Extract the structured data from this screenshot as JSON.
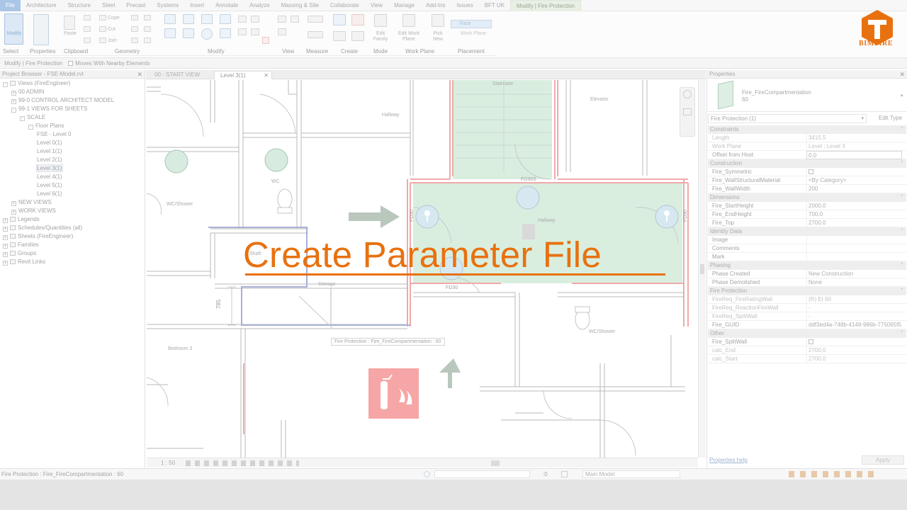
{
  "ribbon": {
    "tabs": [
      "File",
      "Architecture",
      "Structure",
      "Steel",
      "Precast",
      "Systems",
      "Insert",
      "Annotate",
      "Analyze",
      "Massing & Site",
      "Collaborate",
      "View",
      "Manage",
      "Add-Ins",
      "Issues",
      "BFT UK",
      "Modify | Fire Protection"
    ],
    "buttons": {
      "modify": "Modify",
      "paste": "Paste",
      "cope": "Cope",
      "cut": "Cut",
      "join": "Join",
      "edit_family": "Edit Family",
      "edit_work_plane": "Edit Work Plane",
      "pick_new": "Pick New",
      "face": "Face",
      "work_plane": "Work Plane"
    },
    "panels": [
      "Select",
      "Properties",
      "Clipboard",
      "Geometry",
      "Modify",
      "View",
      "Measure",
      "Create",
      "Mode",
      "Work Plane",
      "Placement"
    ]
  },
  "options_bar": {
    "label": "Modify | Fire Protection",
    "checkbox_label": "Moves With Nearby Elements"
  },
  "project_browser": {
    "title": "Project Browser - FSE-Model.rvt",
    "items": [
      {
        "label": "Views (FireEngineer)",
        "level": 0,
        "toggle": "-",
        "icon": true
      },
      {
        "label": "00 ADMIN",
        "level": 1,
        "toggle": "+"
      },
      {
        "label": "99-0 CONTROL ARCHITECT MODEL",
        "level": 1,
        "toggle": "+"
      },
      {
        "label": "99-1 VIEWS FOR SHEETS",
        "level": 1,
        "toggle": "-"
      },
      {
        "label": "SCALE",
        "level": 2,
        "toggle": "-"
      },
      {
        "label": "Floor Plans",
        "level": 3,
        "toggle": "-"
      },
      {
        "label": "FSE - Level 0",
        "level": 4
      },
      {
        "label": "Level 0(1)",
        "level": 4
      },
      {
        "label": "Level 1(1)",
        "level": 4
      },
      {
        "label": "Level 2(1)",
        "level": 4
      },
      {
        "label": "Level 3(1)",
        "level": 4,
        "selected": true
      },
      {
        "label": "Level 4(1)",
        "level": 4
      },
      {
        "label": "Level 5(1)",
        "level": 4
      },
      {
        "label": "Level 6(1)",
        "level": 4
      },
      {
        "label": "NEW VIEWS",
        "level": 1,
        "toggle": "+"
      },
      {
        "label": "WORK VIEWS",
        "level": 1,
        "toggle": "+"
      },
      {
        "label": "Legends",
        "level": 0,
        "toggle": "+",
        "icon": true
      },
      {
        "label": "Schedules/Quantities (all)",
        "level": 0,
        "toggle": "+",
        "icon": true
      },
      {
        "label": "Sheets (FireEngineer)",
        "level": 0,
        "toggle": "+",
        "icon": true
      },
      {
        "label": "Families",
        "level": 0,
        "toggle": "+",
        "icon": true
      },
      {
        "label": "Groups",
        "level": 0,
        "toggle": "+",
        "icon": true
      },
      {
        "label": "Revit Links",
        "level": 0,
        "toggle": "+",
        "icon": true
      }
    ]
  },
  "view_tabs": [
    "00 - START VIEW",
    "Level 3(1)"
  ],
  "plan": {
    "rooms": [
      "Staircase",
      "Hallway",
      "Elevator",
      "WC",
      "WC/Shower",
      "Shaft",
      "Storage",
      "Hallway",
      "Bedroom 3",
      "WC/Shower"
    ],
    "tags": [
      "FD30S",
      "FD30",
      "FD30",
      "FD30"
    ],
    "dimension": "785",
    "tooltip": "Fire Protection : Fire_FireCompartmentation : 60",
    "scale": "1 : 50"
  },
  "banner": {
    "title": "Create Parameter File"
  },
  "logo": {
    "text": "BIMFIRE"
  },
  "properties": {
    "title": "Properties",
    "family": "Fire_FireCompartmentation",
    "type": "60",
    "selector": "Fire Protection (1)",
    "edit_type": "Edit Type",
    "sections": [
      {
        "name": "Constraints",
        "rows": [
          [
            "Length",
            "3415.5",
            true
          ],
          [
            "Work Plane",
            "Level : Level 3",
            true
          ],
          [
            "Offset from Host",
            "0.0",
            false
          ]
        ]
      },
      {
        "name": "Construction",
        "rows": [
          [
            "Fire_Symmetric",
            "",
            false
          ],
          [
            "Fire_WallStructuralMaterial",
            "<By Category>",
            false
          ],
          [
            "Fire_WallWidth",
            "200",
            false
          ]
        ]
      },
      {
        "name": "Dimensions",
        "rows": [
          [
            "Fire_StartHeight",
            "2000.0",
            false
          ],
          [
            "Fire_EndHeight",
            "700.0",
            false
          ],
          [
            "Fire_Top",
            "2700.0",
            false
          ]
        ]
      },
      {
        "name": "Identity Data",
        "rows": [
          [
            "Image",
            "",
            false
          ],
          [
            "Comments",
            "",
            false
          ],
          [
            "Mark",
            "",
            false
          ]
        ]
      },
      {
        "name": "Phasing",
        "rows": [
          [
            "Phase Created",
            "New Construction",
            false
          ],
          [
            "Phase Demolished",
            "None",
            false
          ]
        ]
      },
      {
        "name": "Fire Protection",
        "rows": [
          [
            "FireReq_FireRatingWall",
            "(R) EI 60",
            true
          ],
          [
            "FireReq_ReactionFireWall",
            "-",
            true
          ],
          [
            "FireReq_SplitWall",
            "-",
            true
          ],
          [
            "Fire_GUID",
            "ddf3ed4a-748b-4148-986b-775065f5...",
            false
          ]
        ]
      },
      {
        "name": "Other",
        "rows": [
          [
            "Fire_SplitWall",
            "",
            false
          ],
          [
            "calc_End",
            "2700.0",
            true
          ],
          [
            "calc_Start",
            "2700.0",
            true
          ]
        ]
      }
    ],
    "help": "Properties help",
    "apply": "Apply"
  },
  "status": {
    "text": "Fire Protection : Fire_FireCompartmentation : 60",
    "count": ":0",
    "model": "Main Model"
  },
  "colors": {
    "accent": "#e8710f",
    "fire_zone": "#d7ecdd",
    "fire_wall": "#f1a8a8"
  }
}
